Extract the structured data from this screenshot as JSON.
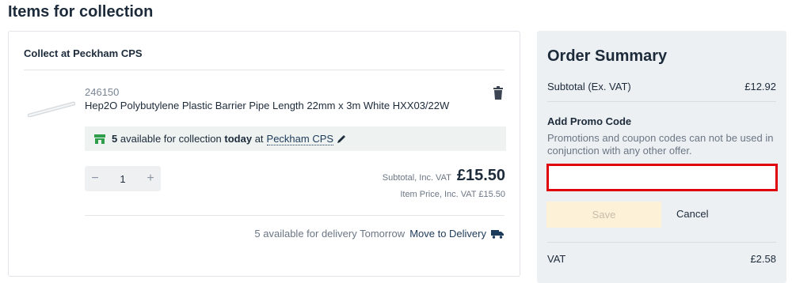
{
  "page": {
    "title": "Items for collection"
  },
  "collection": {
    "heading": "Collect at Peckham CPS",
    "item": {
      "sku": "246150",
      "name": "Hep2O Polybutylene Plastic Barrier Pipe Length 22mm x 3m White HXX03/22W",
      "availability": {
        "count": "5",
        "text_before": "available for collection",
        "today": "today",
        "text_at": "at",
        "store": "Peckham CPS"
      },
      "quantity": "1",
      "minus": "−",
      "plus": "+",
      "subtotal_label": "Subtotal, Inc. VAT",
      "subtotal_value": "£15.50",
      "item_price": "Item Price, Inc. VAT £15.50",
      "delivery_text": "5 available for delivery Tomorrow",
      "delivery_link": "Move to Delivery"
    }
  },
  "summary": {
    "title": "Order Summary",
    "subtotal_label": "Subtotal (Ex. VAT)",
    "subtotal_value": "£12.92",
    "promo_heading": "Add Promo Code",
    "promo_note": "Promotions and coupon codes can not be used in conjunction with any other offer.",
    "promo_placeholder": "",
    "save_label": "Save",
    "cancel_label": "Cancel",
    "vat_label": "VAT",
    "vat_value": "£2.58"
  },
  "colors": {
    "accent_green": "#2e9e4a",
    "highlight_red": "#e0000b",
    "navy": "#1c2a3a"
  },
  "icons": [
    "delete-icon",
    "store-icon",
    "edit-icon",
    "truck-icon"
  ]
}
